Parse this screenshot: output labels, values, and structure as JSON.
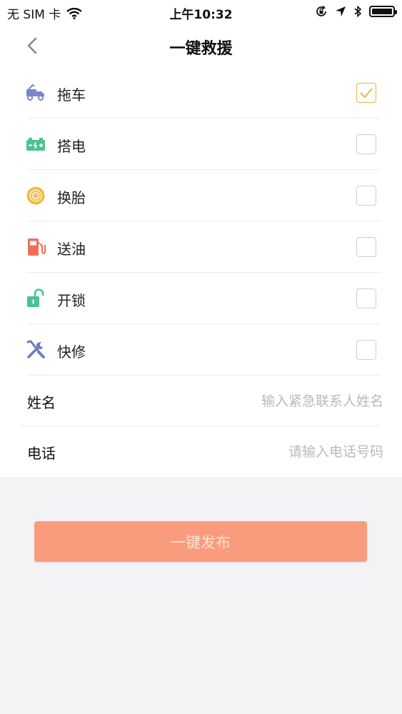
{
  "status_bar": {
    "carrier": "无 SIM 卡",
    "time": "上午10:32"
  },
  "nav": {
    "title": "一键救援"
  },
  "services": [
    {
      "label": "拖车",
      "icon": "tow-truck-icon",
      "checked": true
    },
    {
      "label": "搭电",
      "icon": "battery-icon",
      "checked": false
    },
    {
      "label": "换胎",
      "icon": "tire-icon",
      "checked": false
    },
    {
      "label": "送油",
      "icon": "fuel-pump-icon",
      "checked": false
    },
    {
      "label": "开锁",
      "icon": "unlock-icon",
      "checked": false
    },
    {
      "label": "快修",
      "icon": "tools-icon",
      "checked": false
    }
  ],
  "form": {
    "name_label": "姓名",
    "name_placeholder": "输入紧急联系人姓名",
    "phone_label": "电话",
    "phone_placeholder": "请输入电话号码"
  },
  "publish_label": "一键发布",
  "colors": {
    "accent_check": "#eab54a",
    "publish_button": "#f99c7d",
    "publish_text": "#fde2d8"
  }
}
